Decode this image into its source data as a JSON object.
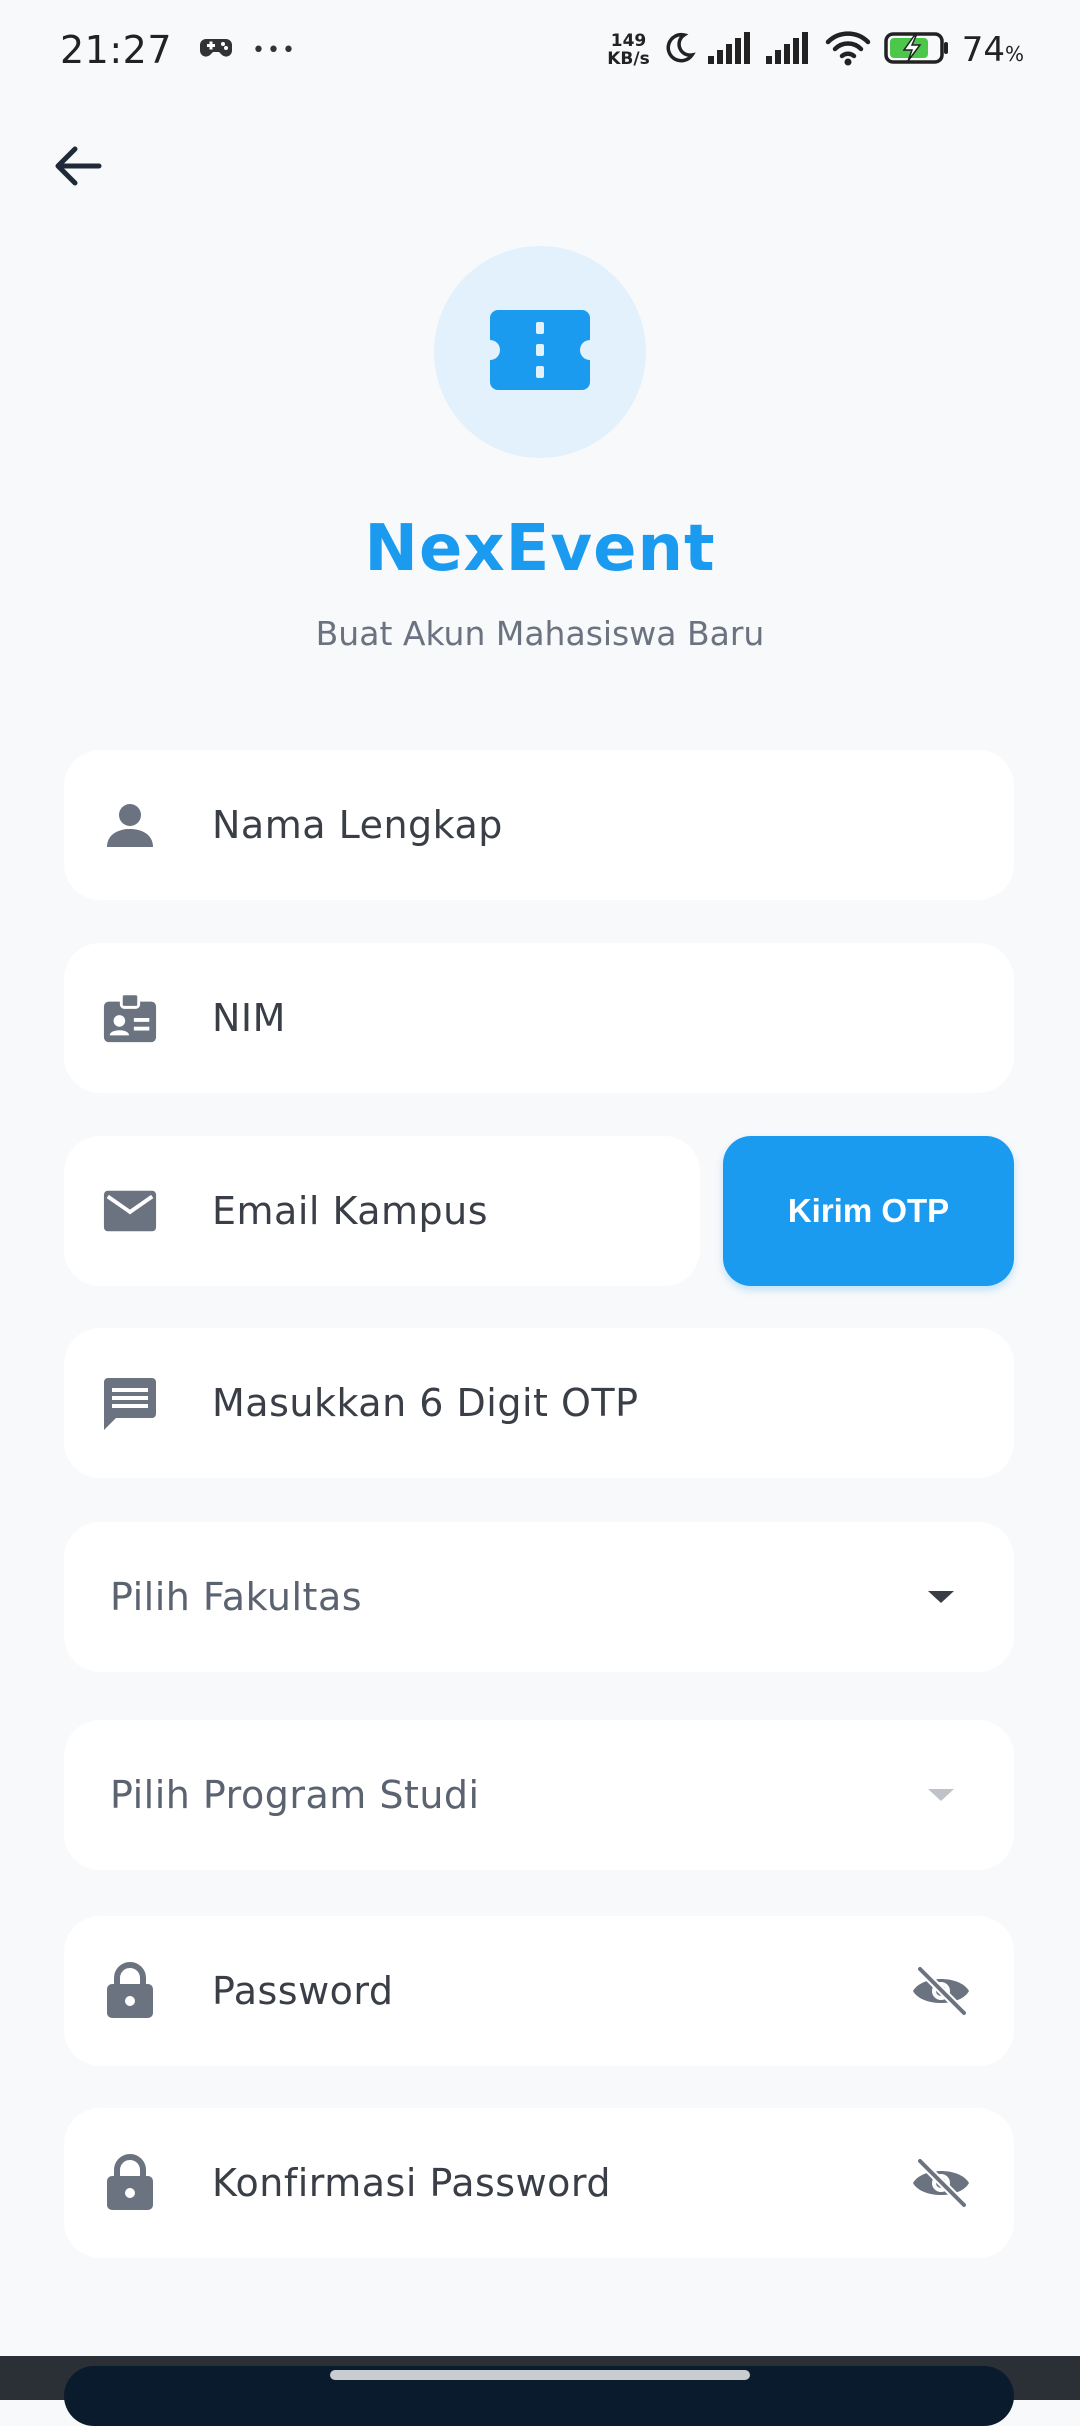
{
  "status_bar": {
    "time": "21:27",
    "overflow": "•••",
    "net_speed_value": "149",
    "net_speed_unit": "KB/s",
    "battery": "74",
    "battery_unit": "%"
  },
  "header": {
    "back_icon": "arrow-left-icon",
    "logo_icon": "ticket-icon",
    "title": "NexEvent",
    "subtitle": "Buat Akun Mahasiswa Baru"
  },
  "form": {
    "name_label": "Nama Lengkap",
    "nim_label": "NIM",
    "email_label": "Email Kampus",
    "otp_button": "Kirim OTP",
    "otp_label": "Masukkan 6 Digit OTP",
    "faculty_label": "Pilih Fakultas",
    "program_label": "Pilih Program Studi",
    "password_label": "Password",
    "confirm_password_label": "Konfirmasi Password"
  },
  "colors": {
    "accent": "#1A9BF0",
    "logo_bg": "#E3F1FD",
    "icon_gray": "#6B7280",
    "background": "#F8F9FB"
  }
}
